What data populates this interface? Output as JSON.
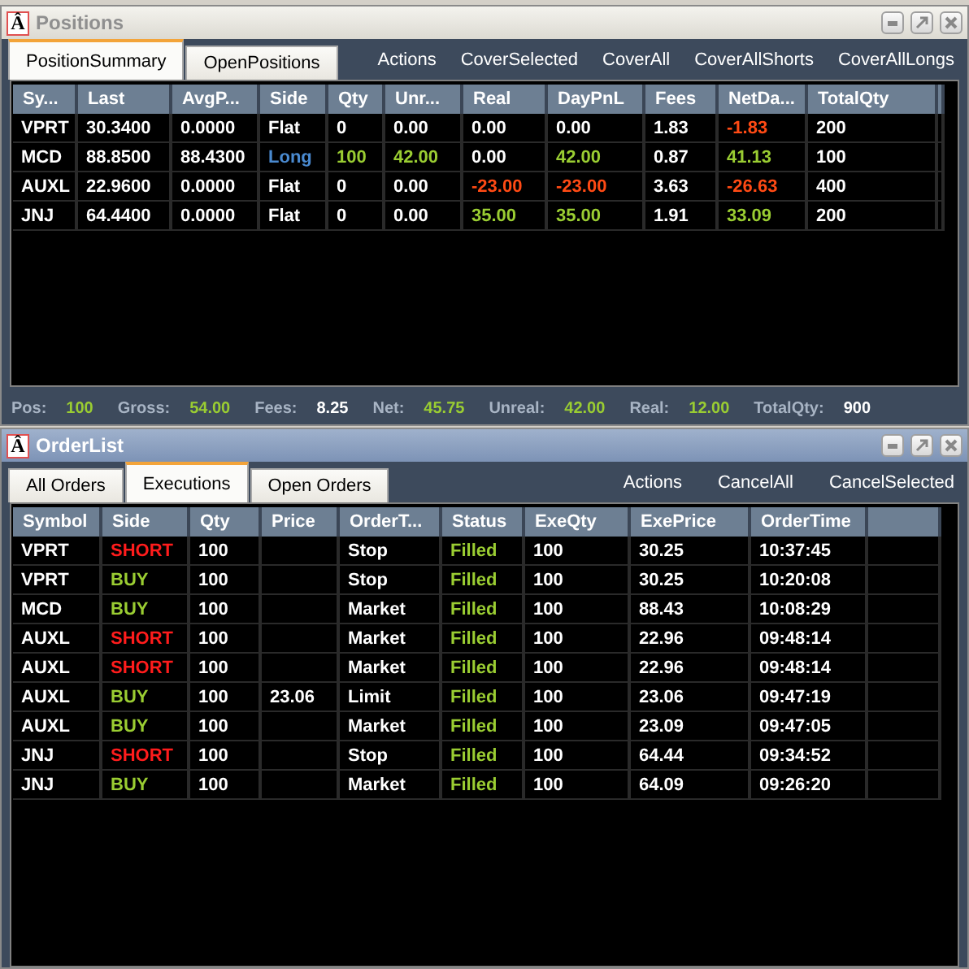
{
  "positions_window": {
    "logo": "Â",
    "title": "Positions",
    "active": false,
    "tabs": [
      {
        "label": "PositionSummary",
        "selected": true
      },
      {
        "label": "OpenPositions",
        "selected": false
      }
    ],
    "actions": [
      "Actions",
      "CoverSelected",
      "CoverAll",
      "CoverAllShorts",
      "CoverAllLongs"
    ],
    "table": {
      "columns": [
        "Sy...",
        "Last",
        "AvgP...",
        "Side",
        "Qty",
        "Unr...",
        "Real",
        "DayPnL",
        "Fees",
        "NetDa...",
        "TotalQty"
      ],
      "rows": [
        [
          "VPRT",
          "30.3400",
          "0.0000",
          "Flat",
          "0",
          "0.00",
          "0.00",
          "0.00",
          "1.83",
          {
            "text": "-1.83",
            "kind": "negative"
          },
          "200"
        ],
        [
          "MCD",
          "88.8500",
          "88.4300",
          {
            "text": "Long",
            "kind": "long"
          },
          {
            "text": "100",
            "kind": "positive"
          },
          {
            "text": "42.00",
            "kind": "positive"
          },
          "0.00",
          {
            "text": "42.00",
            "kind": "positive"
          },
          "0.87",
          {
            "text": "41.13",
            "kind": "positive"
          },
          "100"
        ],
        [
          "AUXL",
          "22.9600",
          "0.0000",
          "Flat",
          "0",
          "0.00",
          {
            "text": "-23.00",
            "kind": "negative"
          },
          {
            "text": "-23.00",
            "kind": "negative"
          },
          "3.63",
          {
            "text": "-26.63",
            "kind": "negative"
          },
          "400"
        ],
        [
          "JNJ",
          "64.4400",
          "0.0000",
          "Flat",
          "0",
          "0.00",
          {
            "text": "35.00",
            "kind": "positive"
          },
          {
            "text": "35.00",
            "kind": "positive"
          },
          "1.91",
          {
            "text": "33.09",
            "kind": "positive"
          },
          "200"
        ]
      ]
    },
    "summary": [
      {
        "label": "Pos:",
        "value": "100",
        "kind": "positive"
      },
      {
        "label": "Gross:",
        "value": "54.00",
        "kind": "positive"
      },
      {
        "label": "Fees:",
        "value": "8.25",
        "kind": "plain"
      },
      {
        "label": "Net:",
        "value": "45.75",
        "kind": "positive"
      },
      {
        "label": "Unreal:",
        "value": "42.00",
        "kind": "positive"
      },
      {
        "label": "Real:",
        "value": "12.00",
        "kind": "positive"
      },
      {
        "label": "TotalQty:",
        "value": "900",
        "kind": "plain"
      }
    ]
  },
  "orderlist_window": {
    "logo": "Â",
    "title": "OrderList",
    "active": true,
    "tabs": [
      {
        "label": "All Orders",
        "selected": false
      },
      {
        "label": "Executions",
        "selected": true
      },
      {
        "label": "Open Orders",
        "selected": false
      }
    ],
    "actions": [
      "Actions",
      "CancelAll",
      "CancelSelected"
    ],
    "table": {
      "columns": [
        "Symbol",
        "Side",
        "Qty",
        "Price",
        "OrderT...",
        "Status",
        "ExeQty",
        "ExePrice",
        "OrderTime"
      ],
      "rows": [
        [
          "VPRT",
          {
            "text": "SHORT",
            "kind": "short"
          },
          "100",
          "",
          "Stop",
          {
            "text": "Filled",
            "kind": "positive"
          },
          "100",
          "30.25",
          "10:37:45"
        ],
        [
          "VPRT",
          {
            "text": "BUY",
            "kind": "positive"
          },
          "100",
          "",
          "Stop",
          {
            "text": "Filled",
            "kind": "positive"
          },
          "100",
          "30.25",
          "10:20:08"
        ],
        [
          "MCD",
          {
            "text": "BUY",
            "kind": "positive"
          },
          "100",
          "",
          "Market",
          {
            "text": "Filled",
            "kind": "positive"
          },
          "100",
          "88.43",
          "10:08:29"
        ],
        [
          "AUXL",
          {
            "text": "SHORT",
            "kind": "short"
          },
          "100",
          "",
          "Market",
          {
            "text": "Filled",
            "kind": "positive"
          },
          "100",
          "22.96",
          "09:48:14"
        ],
        [
          "AUXL",
          {
            "text": "SHORT",
            "kind": "short"
          },
          "100",
          "",
          "Market",
          {
            "text": "Filled",
            "kind": "positive"
          },
          "100",
          "22.96",
          "09:48:14"
        ],
        [
          "AUXL",
          {
            "text": "BUY",
            "kind": "positive"
          },
          "100",
          "23.06",
          "Limit",
          {
            "text": "Filled",
            "kind": "positive"
          },
          "100",
          "23.06",
          "09:47:19"
        ],
        [
          "AUXL",
          {
            "text": "BUY",
            "kind": "positive"
          },
          "100",
          "",
          "Market",
          {
            "text": "Filled",
            "kind": "positive"
          },
          "100",
          "23.09",
          "09:47:05"
        ],
        [
          "JNJ",
          {
            "text": "SHORT",
            "kind": "short"
          },
          "100",
          "",
          "Stop",
          {
            "text": "Filled",
            "kind": "positive"
          },
          "100",
          "64.44",
          "09:34:52"
        ],
        [
          "JNJ",
          {
            "text": "BUY",
            "kind": "positive"
          },
          "100",
          "",
          "Market",
          {
            "text": "Filled",
            "kind": "positive"
          },
          "100",
          "64.09",
          "09:26:20"
        ]
      ]
    }
  }
}
